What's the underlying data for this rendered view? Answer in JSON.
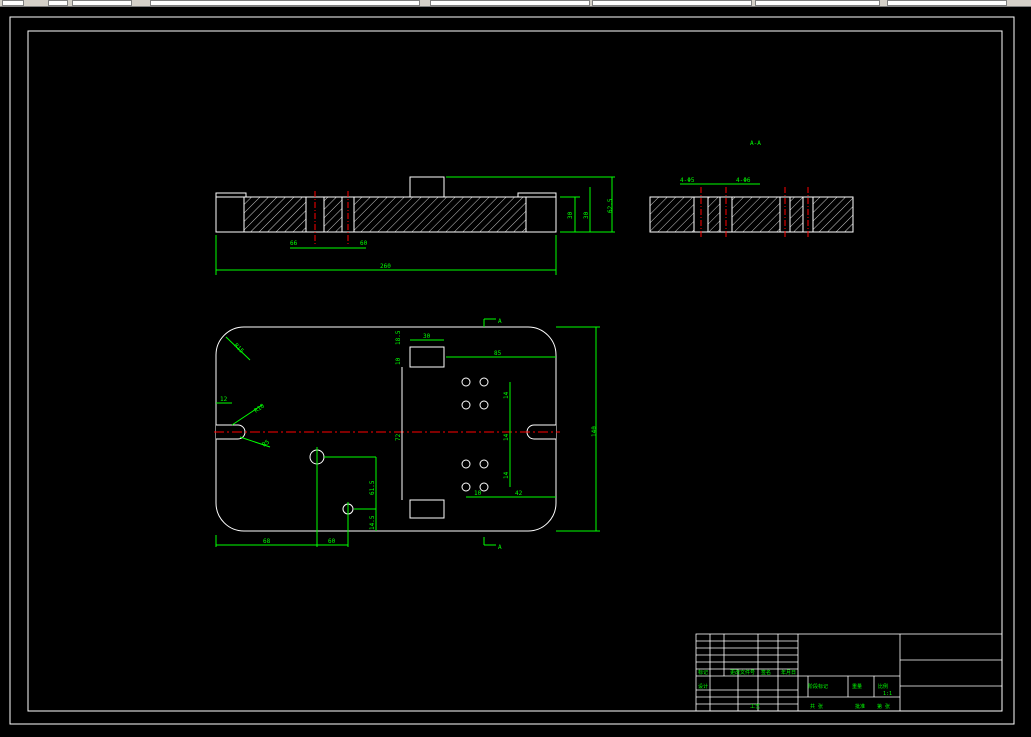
{
  "colors": {
    "background": "#000000",
    "geometry": "#ffffff",
    "dimension": "#00ff00",
    "centerline": "#ff0000",
    "toolbar": "#d4d0c8"
  },
  "toolbar": {
    "icons": [
      "app-menu-icon",
      "open-icon",
      "properties-icon",
      "layer-combo",
      "linetype-combo",
      "color-combo"
    ]
  },
  "drawing": {
    "section_label": "A-A",
    "section_marker": "A",
    "front_view_dims": {
      "overall_length": "260",
      "left_offset": "66",
      "right_offset": "60",
      "thickness_a": "30",
      "thickness_b": "30",
      "total_height": "62.5"
    },
    "section_view_dims": {
      "hole_a": "4-Φ5",
      "hole_b": "4-Φ6"
    },
    "plan_view_dims": {
      "corner_radius": "R15",
      "slot_width": "12",
      "slot_radius": "R10",
      "slot_depth": "R5",
      "block_width": "30",
      "block_height": "10",
      "block_offset": "18.5",
      "block_right": "85",
      "center_height": "72",
      "overall_height": "140",
      "hole_spacing_a": "14",
      "hole_spacing_b": "14",
      "hole_spacing_c": "14",
      "hole_row_offset": "10",
      "hole_right_offset": "42",
      "pin_x": "68",
      "pin_x2": "60",
      "pin_y": "61.5",
      "pin_y2": "14.5"
    }
  },
  "title_block": {
    "row_labels": [
      "标记",
      "处数",
      "分区",
      "更改文件号",
      "签名",
      "年月日"
    ],
    "design": "设计",
    "standardize": "标准化",
    "stage_mark": "阶段标记",
    "weight": "重量",
    "scale": "比例",
    "scale_value": "1:1",
    "review": "审核",
    "process": "工艺",
    "approve": "批准",
    "sheet_total": "共 张",
    "sheet_no": "第 张"
  }
}
